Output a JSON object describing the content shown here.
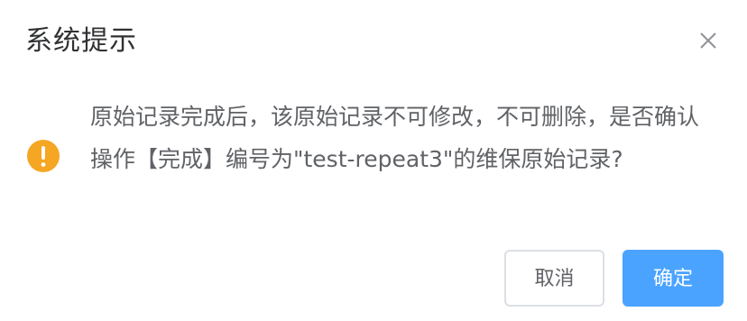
{
  "dialog": {
    "title": "系统提示",
    "message": "原始记录完成后，该原始记录不可修改，不可删除，是否确认操作【完成】编号为\"test-repeat3\"的维保原始记录?",
    "cancel_label": "取消",
    "confirm_label": "确定"
  },
  "icons": {
    "close": "close-icon",
    "status": "warning-icon"
  },
  "colors": {
    "warning": "#f5a623",
    "primary": "#4aa3ff",
    "text": "#606266",
    "title": "#303133",
    "border": "#dcdfe6"
  }
}
